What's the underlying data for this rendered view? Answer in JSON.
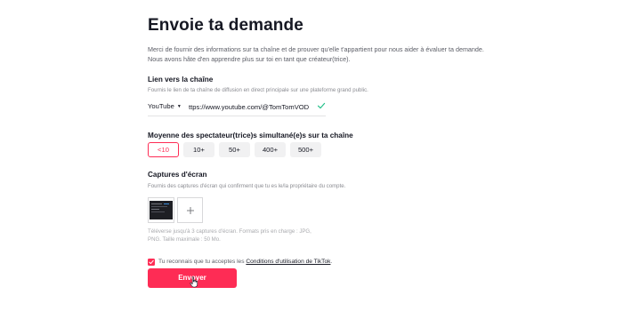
{
  "form": {
    "title": "Envoie ta demande",
    "intro": "Merci de fournir des informations sur ta chaîne et de prouver qu'elle t'appartient pour nous aider à évaluer ta demande. Nous avons hâte d'en apprendre plus sur toi en tant que créateur(trice).",
    "channel_link": {
      "label": "Lien vers la chaîne",
      "help": "Fournis le lien de ta chaîne de diffusion en direct principale sur une plateforme grand public.",
      "platform": "YouTube",
      "platform_icon": "caret-down-icon",
      "url_value": "ttps://www.youtube.com/@TomTomVOD",
      "status_icon": "checkmark-icon",
      "status_color": "#25c08a"
    },
    "viewers": {
      "label": "Moyenne des spectateur(trice)s simultané(e)s sur ta chaîne",
      "options": [
        "<10",
        "10+",
        "50+",
        "400+",
        "500+"
      ],
      "selected": "<10"
    },
    "screenshots": {
      "label": "Captures d'écran",
      "help": "Fournis des captures d'écran qui confirment que tu es le/la propriétaire du compte.",
      "add_icon": "plus-icon",
      "upload_help": "Téléverse jusqu'à 3 captures d'écran. Formats pris en charge : JPG, PNG. Taille maximale : 50 Mo."
    },
    "consent": {
      "text": "Tu reconnais que tu acceptes les ",
      "link": "Conditions d'utilisation de TikTok",
      "suffix": ".",
      "checked": true
    },
    "submit_label": "Envoyer"
  },
  "colors": {
    "accent": "#fe2c55",
    "text": "#161823",
    "muted": "#8a8b91",
    "success": "#25c08a"
  }
}
